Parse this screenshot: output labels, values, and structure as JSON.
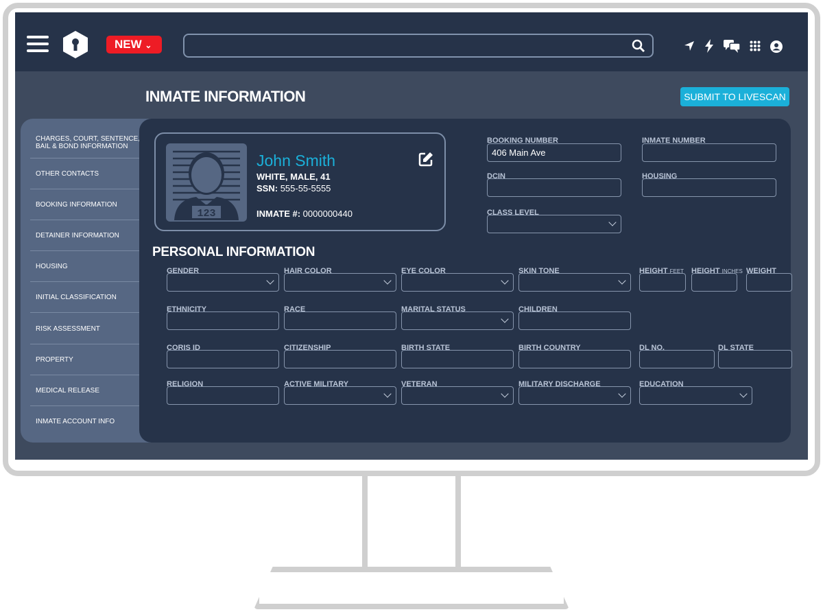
{
  "topbar": {
    "new_label": "NEW",
    "search_placeholder": "",
    "icons": [
      "menu-icon",
      "keyhole-logo-icon",
      "search-icon",
      "location-arrow-icon",
      "bolt-icon",
      "chat-icon",
      "apps-grid-icon",
      "user-icon"
    ]
  },
  "header": {
    "title": "INMATE INFORMATION",
    "livescan_label": "SUBMIT TO LIVESCAN"
  },
  "colors": {
    "accent": "#1bb0d9",
    "new": "#ee1c25",
    "panel": "#263349",
    "sidebar": "#566783"
  },
  "sidebar": {
    "items": [
      {
        "label": "CHARGES, COURT, SENTENCE, BAIL & BOND INFORMATION"
      },
      {
        "label": "OTHER CONTACTS"
      },
      {
        "label": "BOOKING INFORMATION"
      },
      {
        "label": "DETAINER INFORMATION"
      },
      {
        "label": "HOUSING"
      },
      {
        "label": "INITIAL CLASSIFICATION"
      },
      {
        "label": "RISK ASSESSMENT"
      },
      {
        "label": "PROPERTY"
      },
      {
        "label": "MEDICAL RELEASE"
      },
      {
        "label": "INMATE ACCOUNT INFO"
      }
    ]
  },
  "inmate": {
    "name": "John Smith",
    "demographics": "WHITE, MALE, 41",
    "ssn_label": "SSN:",
    "ssn": "555-55-5555",
    "inmate_no_label": "INMATE #:",
    "inmate_no": "0000000440",
    "photo_placard": "123"
  },
  "booking": {
    "fields": [
      {
        "label": "BOOKING NUMBER",
        "value": "406 Main Ave",
        "type": "text"
      },
      {
        "label": "INMATE NUMBER",
        "value": "",
        "type": "text"
      },
      {
        "label": "DCIN",
        "value": "",
        "type": "text"
      },
      {
        "label": "HOUSING",
        "value": "",
        "type": "text"
      },
      {
        "label": "CLASS LEVEL",
        "value": "",
        "type": "select"
      }
    ]
  },
  "personal": {
    "title": "PERSONAL INFORMATION",
    "fields": [
      {
        "label": "GENDER",
        "type": "select"
      },
      {
        "label": "HAIR COLOR",
        "type": "select"
      },
      {
        "label": "EYE COLOR",
        "type": "select"
      },
      {
        "label": "SKIN TONE",
        "type": "select"
      },
      {
        "label": "HEIGHT",
        "unit": "FEET",
        "type": "text"
      },
      {
        "label": "HEIGHT",
        "unit": "INCHES",
        "type": "text"
      },
      {
        "label": "WEIGHT",
        "type": "text"
      },
      {
        "label": "ETHNICITY",
        "type": "text"
      },
      {
        "label": "RACE",
        "type": "text"
      },
      {
        "label": "MARITAL STATUS",
        "type": "select"
      },
      {
        "label": "CHILDREN",
        "type": "text"
      },
      {
        "label": "CORIS ID",
        "type": "text"
      },
      {
        "label": "CITIZENSHIP",
        "type": "text"
      },
      {
        "label": "BIRTH STATE",
        "type": "text"
      },
      {
        "label": "BIRTH COUNTRY",
        "type": "text"
      },
      {
        "label": "DL NO.",
        "type": "text"
      },
      {
        "label": "DL STATE",
        "type": "text"
      },
      {
        "label": "RELIGION",
        "type": "text"
      },
      {
        "label": "ACTIVE MILITARY",
        "type": "select"
      },
      {
        "label": "VETERAN",
        "type": "select"
      },
      {
        "label": "MILITARY DISCHARGE",
        "type": "select"
      },
      {
        "label": "EDUCATION",
        "type": "select"
      }
    ]
  }
}
